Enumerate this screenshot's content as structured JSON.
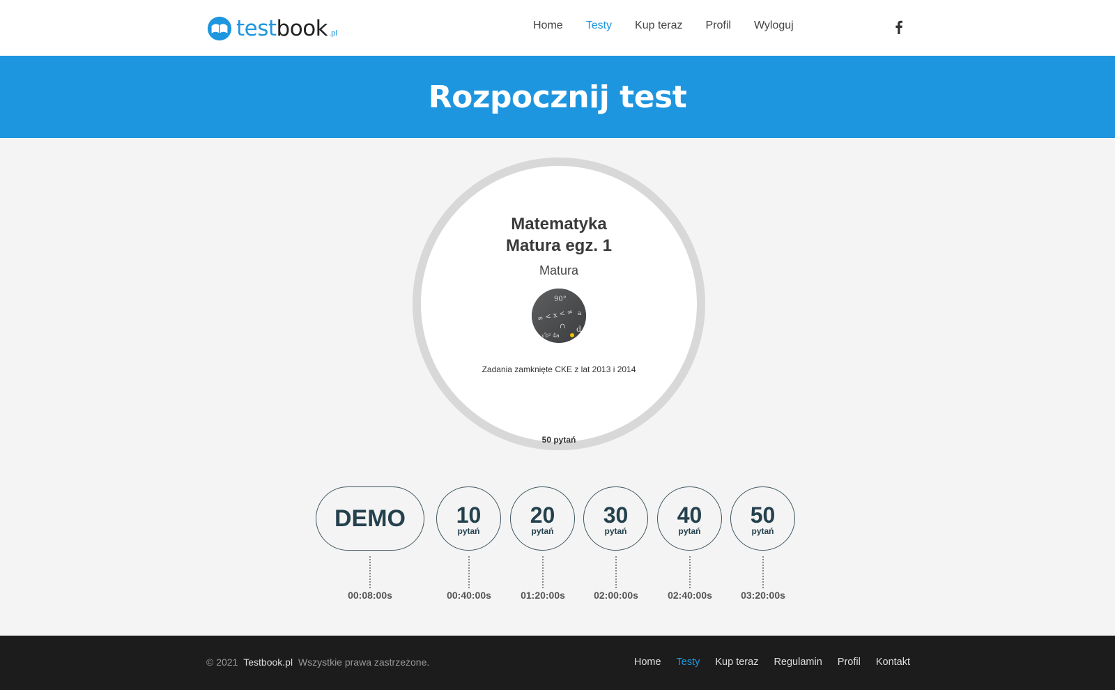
{
  "header": {
    "logo": {
      "part1": "test",
      "part2": "book",
      "suffix": ".pl"
    },
    "nav": [
      {
        "label": "Home",
        "active": false
      },
      {
        "label": "Testy",
        "active": true
      },
      {
        "label": "Kup teraz",
        "active": false
      },
      {
        "label": "Profil",
        "active": false
      },
      {
        "label": "Wyloguj",
        "active": false
      }
    ],
    "social_icon": "facebook-icon"
  },
  "hero": {
    "title": "Rozpocznij test"
  },
  "test_card": {
    "subject": "Matematyka",
    "name": "Matura egz. 1",
    "category": "Matura",
    "thumbnail_icon": "math-formulas-thumbnail",
    "description": "Zadania zamknięte CKE z lat 2013 i 2014",
    "question_count": "50 pytań"
  },
  "options": [
    {
      "value": "DEMO",
      "label": "",
      "time": "00:08:00s"
    },
    {
      "value": "10",
      "label": "pytań",
      "time": "00:40:00s"
    },
    {
      "value": "20",
      "label": "pytań",
      "time": "01:20:00s"
    },
    {
      "value": "30",
      "label": "pytań",
      "time": "02:00:00s"
    },
    {
      "value": "40",
      "label": "pytań",
      "time": "02:40:00s"
    },
    {
      "value": "50",
      "label": "pytań",
      "time": "03:20:00s"
    }
  ],
  "footer": {
    "copyright": "© 2021",
    "brand": "Testbook.pl",
    "rights": "Wszystkie prawa zastrzeżone.",
    "nav": [
      {
        "label": "Home",
        "active": false
      },
      {
        "label": "Testy",
        "active": true
      },
      {
        "label": "Kup teraz",
        "active": false
      },
      {
        "label": "Regulamin",
        "active": false
      },
      {
        "label": "Profil",
        "active": false
      },
      {
        "label": "Kontakt",
        "active": false
      }
    ]
  },
  "colors": {
    "accent": "#1e96df",
    "footer_bg": "#1c1c1c",
    "ring": "#d8d8d8",
    "option_text": "#24414d"
  }
}
